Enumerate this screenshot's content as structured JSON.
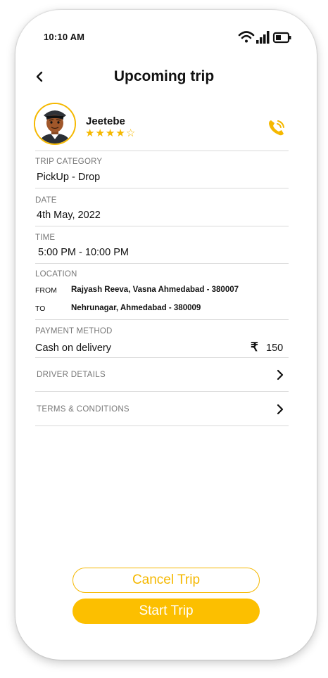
{
  "status_bar": {
    "time": "10:10 AM"
  },
  "header": {
    "title": "Upcoming trip"
  },
  "driver": {
    "name": "Jeetebe",
    "rating": 4,
    "rating_max": 5
  },
  "trip_category": {
    "label": "TRIP CATEGORY",
    "value": "PickUp - Drop"
  },
  "date": {
    "label": "DATE",
    "value": "4th May, 2022"
  },
  "time": {
    "label": "TIME",
    "value": "5:00 PM - 10:00 PM"
  },
  "location": {
    "label": "LOCATION",
    "from_label": "FROM",
    "from": "Rajyash Reeva, Vasna Ahmedabad - 380007",
    "to_label": "TO",
    "to": "Nehrunagar, Ahmedabad - 380009"
  },
  "payment": {
    "label": "PAYMENT METHOD",
    "method": "Cash on delivery",
    "currency": "₹",
    "amount": "150"
  },
  "links": {
    "driver_details": "DRIVER DETAILS",
    "terms": "TERMS & CONDITIONS"
  },
  "actions": {
    "cancel": "Cancel Trip",
    "start": "Start Trip"
  },
  "colors": {
    "accent": "#fcbf00",
    "divider": "#d9d9d9",
    "label": "#777777"
  },
  "icons": [
    "back-arrow-icon",
    "wifi-icon",
    "signal-icon",
    "battery-icon",
    "phone-call-icon",
    "star-icon",
    "rupee-icon",
    "chevron-right-icon"
  ]
}
